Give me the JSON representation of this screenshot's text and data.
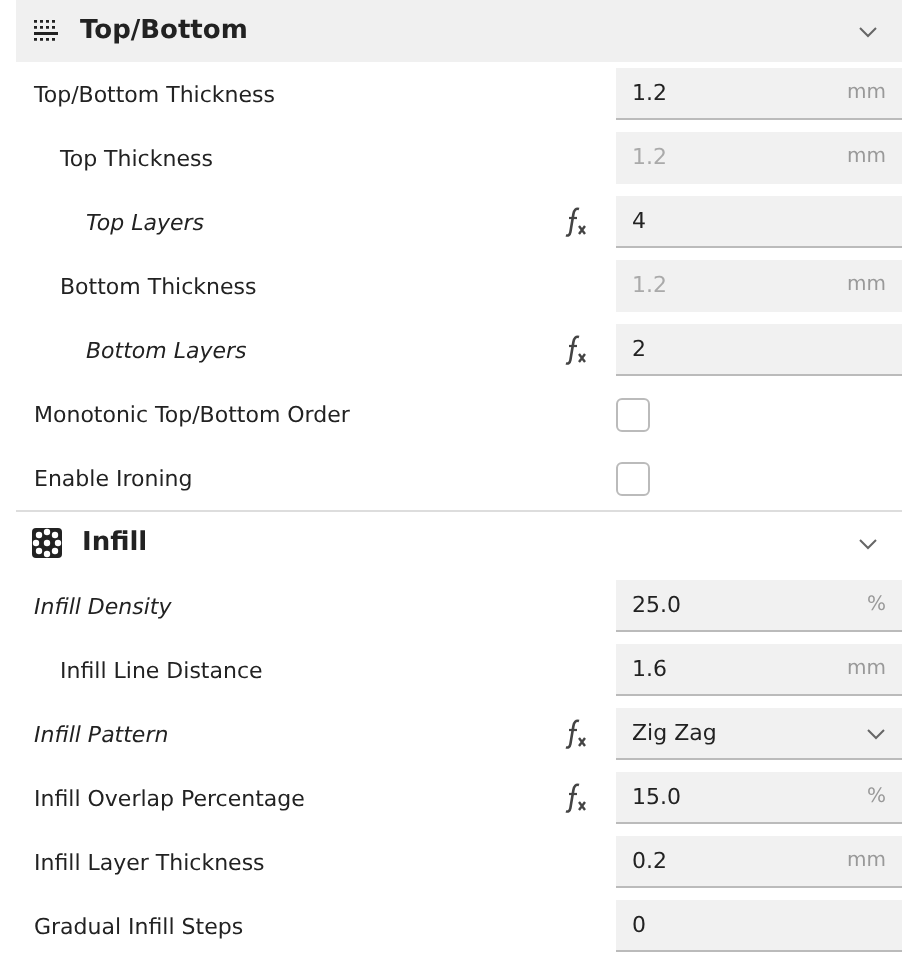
{
  "sections": [
    {
      "title": "Top/Bottom",
      "kind": "top-bottom",
      "expanded": true,
      "highlighted": true,
      "settings": [
        {
          "label": "Top/Bottom Thickness",
          "modified": false,
          "formula": false,
          "kind": "number",
          "value": "1.2",
          "unit": "mm",
          "disabled": false,
          "children": [
            {
              "label": "Top Thickness",
              "modified": false,
              "formula": false,
              "kind": "number",
              "value": "1.2",
              "unit": "mm",
              "disabled": true,
              "children": [
                {
                  "label": "Top Layers",
                  "modified": true,
                  "formula": true,
                  "kind": "number",
                  "value": "4",
                  "disabled": false
                }
              ]
            },
            {
              "label": "Bottom Thickness",
              "modified": false,
              "formula": false,
              "kind": "number",
              "value": "1.2",
              "unit": "mm",
              "disabled": true,
              "children": [
                {
                  "label": "Bottom Layers",
                  "modified": true,
                  "formula": true,
                  "kind": "number",
                  "value": "2",
                  "disabled": false
                }
              ]
            }
          ]
        },
        {
          "label": "Monotonic Top/Bottom Order",
          "modified": false,
          "formula": false,
          "kind": "checkbox",
          "checked": false
        },
        {
          "label": "Enable Ironing",
          "modified": false,
          "formula": false,
          "kind": "checkbox",
          "checked": false
        }
      ]
    },
    {
      "title": "Infill",
      "kind": "infill",
      "expanded": true,
      "highlighted": false,
      "settings": [
        {
          "label": "Infill Density",
          "modified": true,
          "formula": false,
          "kind": "number",
          "value": "25.0",
          "unit": "%",
          "disabled": false,
          "children": [
            {
              "label": "Infill Line Distance",
              "modified": false,
              "formula": false,
              "kind": "number",
              "value": "1.6",
              "unit": "mm",
              "disabled": false
            }
          ]
        },
        {
          "label": "Infill Pattern",
          "modified": true,
          "formula": true,
          "kind": "dropdown",
          "value": "Zig Zag"
        },
        {
          "label": "Infill Overlap Percentage",
          "modified": false,
          "formula": true,
          "kind": "number",
          "value": "15.0",
          "unit": "%",
          "disabled": false
        },
        {
          "label": "Infill Layer Thickness",
          "modified": false,
          "formula": false,
          "kind": "number",
          "value": "0.2",
          "unit": "mm",
          "disabled": false
        },
        {
          "label": "Gradual Infill Steps",
          "modified": false,
          "formula": false,
          "kind": "number",
          "value": "0",
          "disabled": false
        }
      ]
    }
  ]
}
